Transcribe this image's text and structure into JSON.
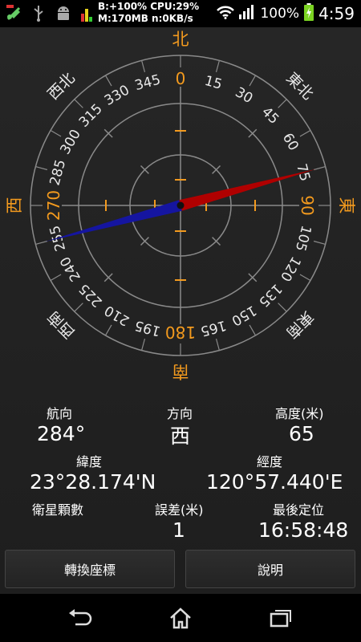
{
  "status_bar": {
    "stats_line1": "B:+100% CPU:29%",
    "stats_line2": "M:170MB n:0KB/s",
    "battery": "100%",
    "time": "4:59",
    "icons": [
      "satellite-app-icon",
      "usb-icon",
      "android-debug-icon",
      "cpu-monitor-icon",
      "wifi-icon",
      "signal-icon",
      "battery-charging-icon"
    ]
  },
  "compass": {
    "cardinals": {
      "north": "北",
      "east": "東",
      "south": "南",
      "west": "西"
    },
    "intercardinals": {
      "ne": "東北",
      "se": "東南",
      "sw": "西南",
      "nw": "西北"
    },
    "degree_labels": [
      "0",
      "15",
      "30",
      "45",
      "60",
      "75",
      "90",
      "105",
      "120",
      "135",
      "150",
      "165",
      "180",
      "195",
      "210",
      "225",
      "240",
      "255",
      "270",
      "285",
      "300",
      "315",
      "330",
      "345"
    ],
    "needle_heading_deg": 75,
    "needle_north_color": "#b00000",
    "needle_south_color": "#1515a0",
    "accent_color": "#f39a1e"
  },
  "info": {
    "heading_label": "航向",
    "heading_value": "284°",
    "direction_label": "方向",
    "direction_value": "西",
    "altitude_label": "高度(米)",
    "altitude_value": "65",
    "latitude_label": "緯度",
    "latitude_value": "23°28.174'N",
    "longitude_label": "經度",
    "longitude_value": "120°57.440'E",
    "satellites_label": "衛星顆數",
    "satellites_value": "",
    "error_label": "誤差(米)",
    "error_value": "1",
    "last_fix_label": "最後定位",
    "last_fix_value": "16:58:48"
  },
  "buttons": {
    "convert": "轉換座標",
    "help": "說明"
  },
  "navbar": {
    "icons": [
      "back-icon",
      "home-icon",
      "recent-apps-icon"
    ]
  }
}
